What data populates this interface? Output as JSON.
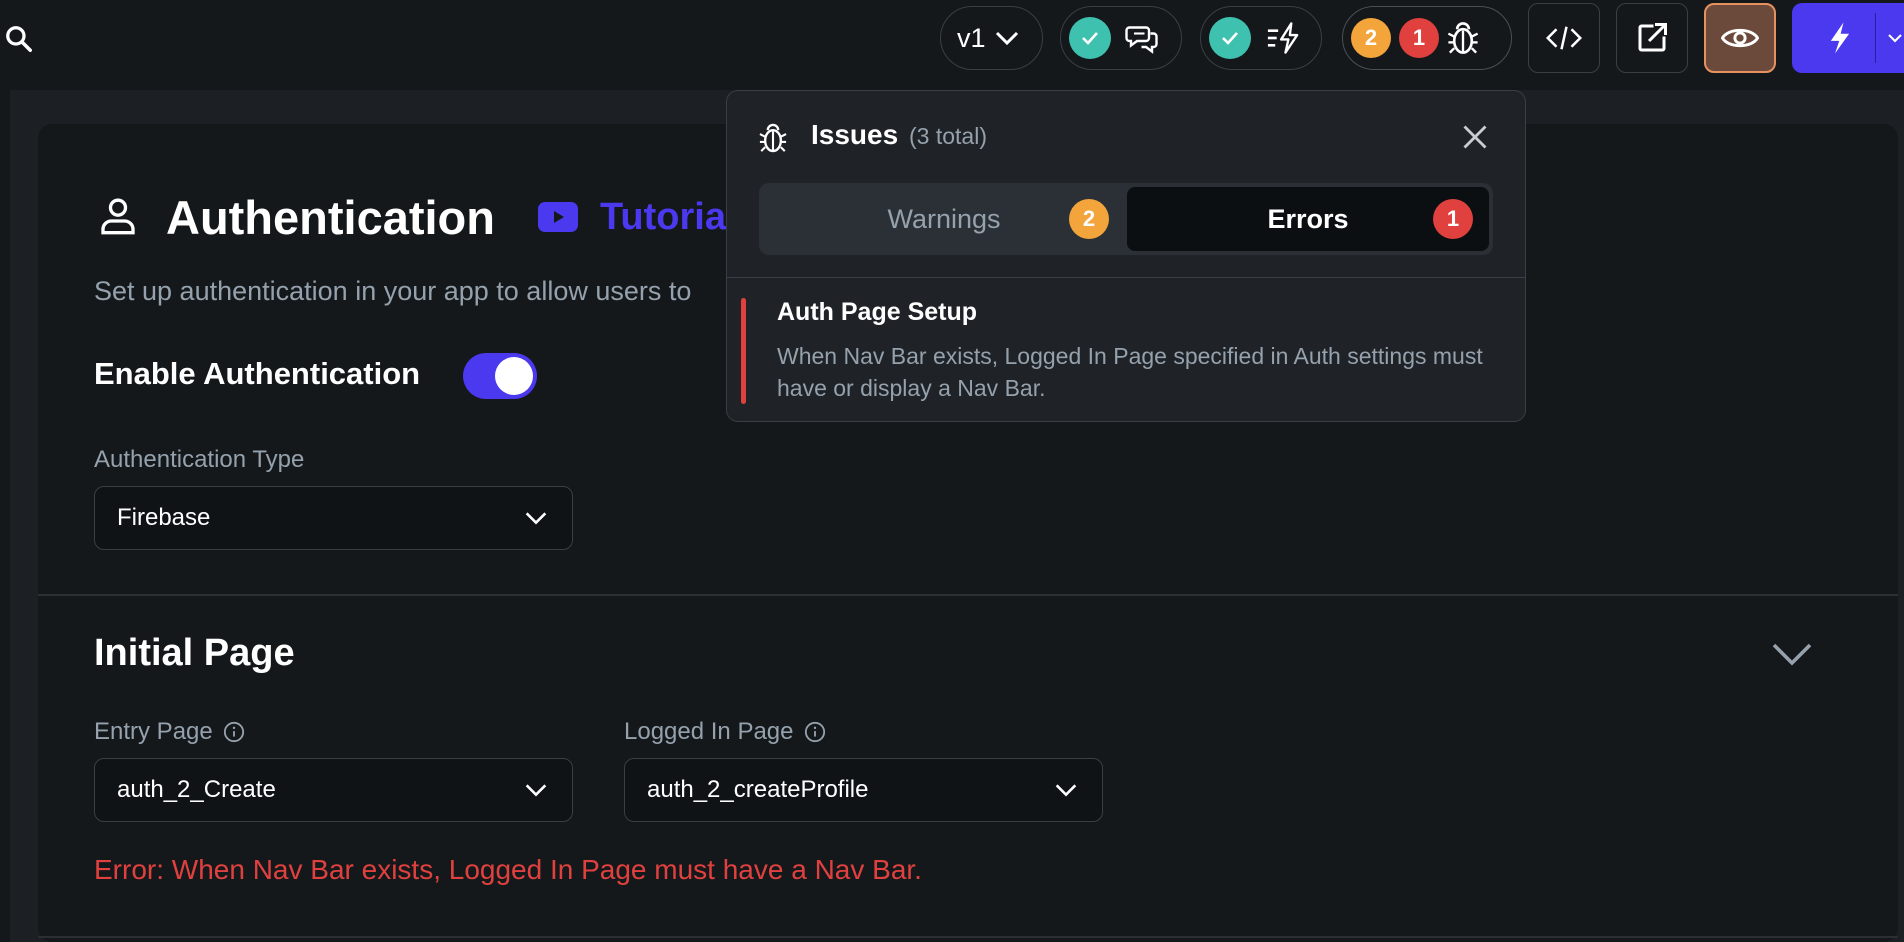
{
  "topbar": {
    "version_label": "v1",
    "warnings_count": "2",
    "errors_count": "1"
  },
  "page": {
    "title": "Authentication",
    "tutorial_label": "Tutoria",
    "subtitle": "Set up authentication in your app to allow users to",
    "enable_label": "Enable Authentication",
    "enable_on": true,
    "auth_type_label": "Authentication Type",
    "auth_type_value": "Firebase"
  },
  "initial_page": {
    "title": "Initial Page",
    "entry_label": "Entry Page",
    "entry_value": "auth_2_Create",
    "logged_in_label": "Logged In Page",
    "logged_in_value": "auth_2_createProfile",
    "error": "Error: When Nav Bar exists, Logged In Page must have a Nav Bar."
  },
  "issues": {
    "title": "Issues",
    "count_text": "(3 total)",
    "tabs": [
      {
        "label": "Warnings",
        "count": "2",
        "active": false
      },
      {
        "label": "Errors",
        "count": "1",
        "active": true
      }
    ],
    "items": [
      {
        "title": "Auth Page Setup",
        "description": "When Nav Bar exists, Logged In Page specified in Auth settings must have or display a Nav Bar."
      }
    ]
  },
  "colors": {
    "accent": "#4b39ef",
    "warning": "#f3a53c",
    "error": "#e0413e",
    "success": "#3fc1b0",
    "preview_button": "#6b4a3c"
  }
}
